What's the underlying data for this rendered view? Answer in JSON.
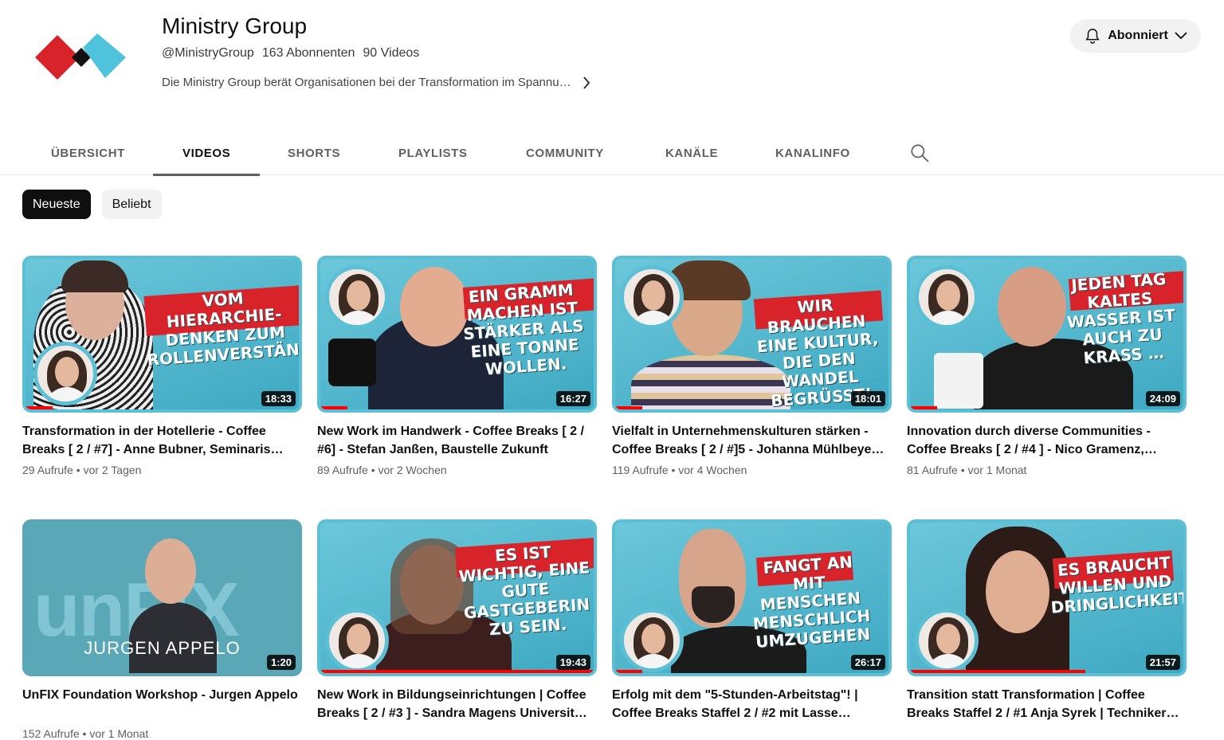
{
  "channel": {
    "name": "Ministry Group",
    "handle": "@MinistryGroup",
    "subscribers": "163 Abonnenten",
    "video_count": "90 Videos",
    "description": "Die Ministry Group berät Organisationen bei der Transformation im Spannu…",
    "subscribe_label": "Abonniert",
    "colors": {
      "logo_red": "#d8232a",
      "logo_blue": "#4fc3dc",
      "logo_black": "#111111"
    }
  },
  "tabs": [
    {
      "label": "ÜBERSICHT"
    },
    {
      "label": "VIDEOS"
    },
    {
      "label": "SHORTS"
    },
    {
      "label": "PLAYLISTS"
    },
    {
      "label": "COMMUNITY"
    },
    {
      "label": "KANÄLE"
    },
    {
      "label": "KANALINFO"
    }
  ],
  "active_tab": "VIDEOS",
  "chips": [
    {
      "label": "Neueste"
    },
    {
      "label": "Beliebt"
    }
  ],
  "videos": [
    {
      "title": "Transformation in der Hotellerie - Coffee Breaks [ 2 / #7] - Anne Bubner, Seminaris…",
      "views": "29 Aufrufe",
      "age": "vor 2 Tagen",
      "duration": "18:33",
      "progress": 0.1,
      "thumb_text": "VOM HIERARCHIE-DENKEN ZUM ROLLENVERSTÄNDNIS!"
    },
    {
      "title": "New Work im Handwerk - Coffee Breaks [ 2 / #6] - Stefan Janßen, Baustelle Zukunft",
      "views": "89 Aufrufe",
      "age": "vor 2 Wochen",
      "duration": "16:27",
      "progress": 0.1,
      "thumb_text": "EIN GRAMM MACHEN IST STÄRKER ALS EINE TONNE WOLLEN."
    },
    {
      "title": "Vielfalt in Unternehmenskulturen stärken - Coffee Breaks [ 2 / #]5 - Johanna Mühlbeye…",
      "views": "119 Aufrufe",
      "age": "vor 4 Wochen",
      "duration": "18:01",
      "progress": 0.1,
      "thumb_text": "WIR BRAUCHEN EINE KULTUR, DIE DEN WANDEL BEGRÜßT!"
    },
    {
      "title": "Innovation durch diverse Communities - Coffee Breaks [ 2 / #4 ] - Nico Gramenz,…",
      "views": "81 Aufrufe",
      "age": "vor 1 Monat",
      "duration": "24:09",
      "progress": 0.1,
      "thumb_text": "JEDEN TAG KALTES WASSER IST AUCH ZU KRASS …"
    },
    {
      "title": "UnFIX Foundation Workshop - Jurgen Appelo",
      "views": "152 Aufrufe",
      "age": "vor 1 Monat",
      "duration": "1:20",
      "progress": 0.0,
      "thumb_text": "JURGEN APPELO",
      "thumb_bg_text": "unFIX"
    },
    {
      "title": "New Work in Bildungseinrichtungen | Coffee Breaks [ 2 / #3 ] - Sandra Magens Universit…",
      "views": "",
      "age": "",
      "duration": "19:43",
      "progress": 1.0,
      "thumb_text": "ES IST WICHTIG, EINE GUTE GASTGEBERIN ZU SEIN."
    },
    {
      "title": "Erfolg mit dem \"5-Stunden-Arbeitstag\"! | Coffee Breaks Staffel 2 / #2 mit Lasse…",
      "views": "",
      "age": "",
      "duration": "26:17",
      "progress": 0.1,
      "thumb_text": "FANGT AN MIT MENSCHEN MENSCHLICH UMZUGEHEN"
    },
    {
      "title": "Transition statt Transformation | Coffee Breaks Staffel 2 / #1 Anja Syrek | Techniker…",
      "views": "",
      "age": "",
      "duration": "21:57",
      "progress": 0.6,
      "thumb_text": "ES BRAUCHT WILLEN UND DRINGLICHKEIT!"
    }
  ]
}
